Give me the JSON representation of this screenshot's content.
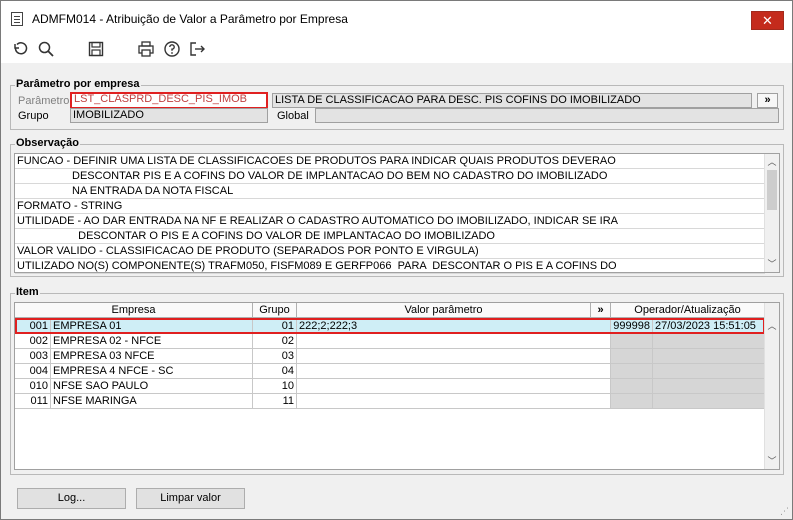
{
  "window": {
    "title": "ADMFM014 - Atribuição de Valor a Parâmetro por Empresa",
    "close_glyph": "✕"
  },
  "toolbar": {
    "icons": [
      "undo-icon",
      "search-icon",
      "save-icon",
      "print-icon",
      "help-icon",
      "exit-icon"
    ]
  },
  "parametro_group": {
    "title": "Parâmetro por empresa",
    "parametro_label": "Parâmetro",
    "parametro_value": "LST_CLASPRD_DESC_PIS_IMOB",
    "descricao_value": "LISTA DE CLASSIFICACAO PARA DESC. PIS COFINS DO IMOBILIZADO",
    "lookup_button": "»",
    "grupo_label": "Grupo",
    "grupo_value": "IMOBILIZADO",
    "global_label": "Global",
    "global_value": ""
  },
  "observacao": {
    "title": "Observação",
    "lines": [
      "FUNCAO - DEFINIR UMA LISTA DE CLASSIFICACOES DE PRODUTOS PARA INDICAR QUAIS PRODUTOS DEVERAO",
      "                  DESCONTAR PIS E A COFINS DO VALOR DE IMPLANTACAO DO BEM NO CADASTRO DO IMOBILIZADO",
      "                  NA ENTRADA DA NOTA FISCAL",
      "FORMATO - STRING",
      "UTILIDADE - AO DAR ENTRADA NA NF E REALIZAR O CADASTRO AUTOMATICO DO IMOBILIZADO, INDICAR SE IRA",
      "                    DESCONTAR O PIS E A COFINS DO VALOR DE IMPLANTACAO DO IMOBILIZADO",
      "VALOR VALIDO - CLASSIFICACAO DE PRODUTO (SEPARADOS POR PONTO E VIRGULA)",
      "UTILIZADO NO(S) COMPONENTE(S) TRAFM050, FISFM089 E GERFP066  PARA  DESCONTAR O PIS E A COFINS DO"
    ]
  },
  "item": {
    "title": "Item",
    "headers": {
      "empresa": "Empresa",
      "grupo": "Grupo",
      "valor": "Valor parâmetro",
      "lookup": "»",
      "operador": "Operador/Atualização"
    },
    "rows": [
      {
        "codigo": "001",
        "empresa": "EMPRESA 01",
        "grupo": "01",
        "valor": "222;2;222;3",
        "operador": "999998",
        "atualizacao": "27/03/2023 15:51:05"
      },
      {
        "codigo": "002",
        "empresa": "EMPRESA 02 - NFCE",
        "grupo": "02",
        "valor": "",
        "operador": "",
        "atualizacao": ""
      },
      {
        "codigo": "003",
        "empresa": "EMPRESA 03 NFCE",
        "grupo": "03",
        "valor": "",
        "operador": "",
        "atualizacao": ""
      },
      {
        "codigo": "004",
        "empresa": "EMPRESA 4 NFCE - SC",
        "grupo": "04",
        "valor": "",
        "operador": "",
        "atualizacao": ""
      },
      {
        "codigo": "010",
        "empresa": "NFSE SAO PAULO",
        "grupo": "10",
        "valor": "",
        "operador": "",
        "atualizacao": ""
      },
      {
        "codigo": "011",
        "empresa": "NFSE MARINGA",
        "grupo": "11",
        "valor": "",
        "operador": "",
        "atualizacao": ""
      }
    ]
  },
  "buttons": {
    "log": "Log...",
    "limpar": "Limpar valor"
  }
}
